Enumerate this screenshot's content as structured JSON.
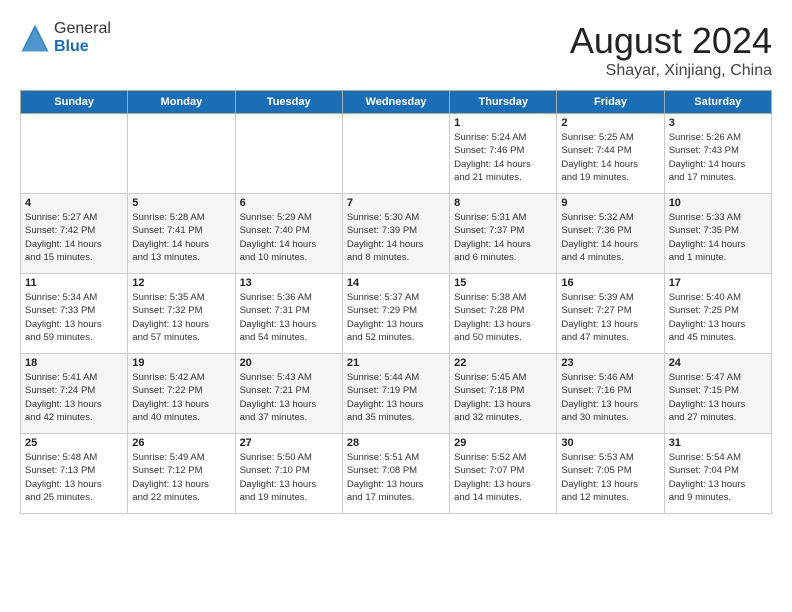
{
  "header": {
    "logo": {
      "general": "General",
      "blue": "Blue"
    },
    "title": "August 2024",
    "subtitle": "Shayar, Xinjiang, China"
  },
  "weekdays": [
    "Sunday",
    "Monday",
    "Tuesday",
    "Wednesday",
    "Thursday",
    "Friday",
    "Saturday"
  ],
  "weeks": [
    [
      {
        "day": "",
        "info": ""
      },
      {
        "day": "",
        "info": ""
      },
      {
        "day": "",
        "info": ""
      },
      {
        "day": "",
        "info": ""
      },
      {
        "day": "1",
        "info": "Sunrise: 5:24 AM\nSunset: 7:46 PM\nDaylight: 14 hours\nand 21 minutes."
      },
      {
        "day": "2",
        "info": "Sunrise: 5:25 AM\nSunset: 7:44 PM\nDaylight: 14 hours\nand 19 minutes."
      },
      {
        "day": "3",
        "info": "Sunrise: 5:26 AM\nSunset: 7:43 PM\nDaylight: 14 hours\nand 17 minutes."
      }
    ],
    [
      {
        "day": "4",
        "info": "Sunrise: 5:27 AM\nSunset: 7:42 PM\nDaylight: 14 hours\nand 15 minutes."
      },
      {
        "day": "5",
        "info": "Sunrise: 5:28 AM\nSunset: 7:41 PM\nDaylight: 14 hours\nand 13 minutes."
      },
      {
        "day": "6",
        "info": "Sunrise: 5:29 AM\nSunset: 7:40 PM\nDaylight: 14 hours\nand 10 minutes."
      },
      {
        "day": "7",
        "info": "Sunrise: 5:30 AM\nSunset: 7:39 PM\nDaylight: 14 hours\nand 8 minutes."
      },
      {
        "day": "8",
        "info": "Sunrise: 5:31 AM\nSunset: 7:37 PM\nDaylight: 14 hours\nand 6 minutes."
      },
      {
        "day": "9",
        "info": "Sunrise: 5:32 AM\nSunset: 7:36 PM\nDaylight: 14 hours\nand 4 minutes."
      },
      {
        "day": "10",
        "info": "Sunrise: 5:33 AM\nSunset: 7:35 PM\nDaylight: 14 hours\nand 1 minute."
      }
    ],
    [
      {
        "day": "11",
        "info": "Sunrise: 5:34 AM\nSunset: 7:33 PM\nDaylight: 13 hours\nand 59 minutes."
      },
      {
        "day": "12",
        "info": "Sunrise: 5:35 AM\nSunset: 7:32 PM\nDaylight: 13 hours\nand 57 minutes."
      },
      {
        "day": "13",
        "info": "Sunrise: 5:36 AM\nSunset: 7:31 PM\nDaylight: 13 hours\nand 54 minutes."
      },
      {
        "day": "14",
        "info": "Sunrise: 5:37 AM\nSunset: 7:29 PM\nDaylight: 13 hours\nand 52 minutes."
      },
      {
        "day": "15",
        "info": "Sunrise: 5:38 AM\nSunset: 7:28 PM\nDaylight: 13 hours\nand 50 minutes."
      },
      {
        "day": "16",
        "info": "Sunrise: 5:39 AM\nSunset: 7:27 PM\nDaylight: 13 hours\nand 47 minutes."
      },
      {
        "day": "17",
        "info": "Sunrise: 5:40 AM\nSunset: 7:25 PM\nDaylight: 13 hours\nand 45 minutes."
      }
    ],
    [
      {
        "day": "18",
        "info": "Sunrise: 5:41 AM\nSunset: 7:24 PM\nDaylight: 13 hours\nand 42 minutes."
      },
      {
        "day": "19",
        "info": "Sunrise: 5:42 AM\nSunset: 7:22 PM\nDaylight: 13 hours\nand 40 minutes."
      },
      {
        "day": "20",
        "info": "Sunrise: 5:43 AM\nSunset: 7:21 PM\nDaylight: 13 hours\nand 37 minutes."
      },
      {
        "day": "21",
        "info": "Sunrise: 5:44 AM\nSunset: 7:19 PM\nDaylight: 13 hours\nand 35 minutes."
      },
      {
        "day": "22",
        "info": "Sunrise: 5:45 AM\nSunset: 7:18 PM\nDaylight: 13 hours\nand 32 minutes."
      },
      {
        "day": "23",
        "info": "Sunrise: 5:46 AM\nSunset: 7:16 PM\nDaylight: 13 hours\nand 30 minutes."
      },
      {
        "day": "24",
        "info": "Sunrise: 5:47 AM\nSunset: 7:15 PM\nDaylight: 13 hours\nand 27 minutes."
      }
    ],
    [
      {
        "day": "25",
        "info": "Sunrise: 5:48 AM\nSunset: 7:13 PM\nDaylight: 13 hours\nand 25 minutes."
      },
      {
        "day": "26",
        "info": "Sunrise: 5:49 AM\nSunset: 7:12 PM\nDaylight: 13 hours\nand 22 minutes."
      },
      {
        "day": "27",
        "info": "Sunrise: 5:50 AM\nSunset: 7:10 PM\nDaylight: 13 hours\nand 19 minutes."
      },
      {
        "day": "28",
        "info": "Sunrise: 5:51 AM\nSunset: 7:08 PM\nDaylight: 13 hours\nand 17 minutes."
      },
      {
        "day": "29",
        "info": "Sunrise: 5:52 AM\nSunset: 7:07 PM\nDaylight: 13 hours\nand 14 minutes."
      },
      {
        "day": "30",
        "info": "Sunrise: 5:53 AM\nSunset: 7:05 PM\nDaylight: 13 hours\nand 12 minutes."
      },
      {
        "day": "31",
        "info": "Sunrise: 5:54 AM\nSunset: 7:04 PM\nDaylight: 13 hours\nand 9 minutes."
      }
    ]
  ]
}
